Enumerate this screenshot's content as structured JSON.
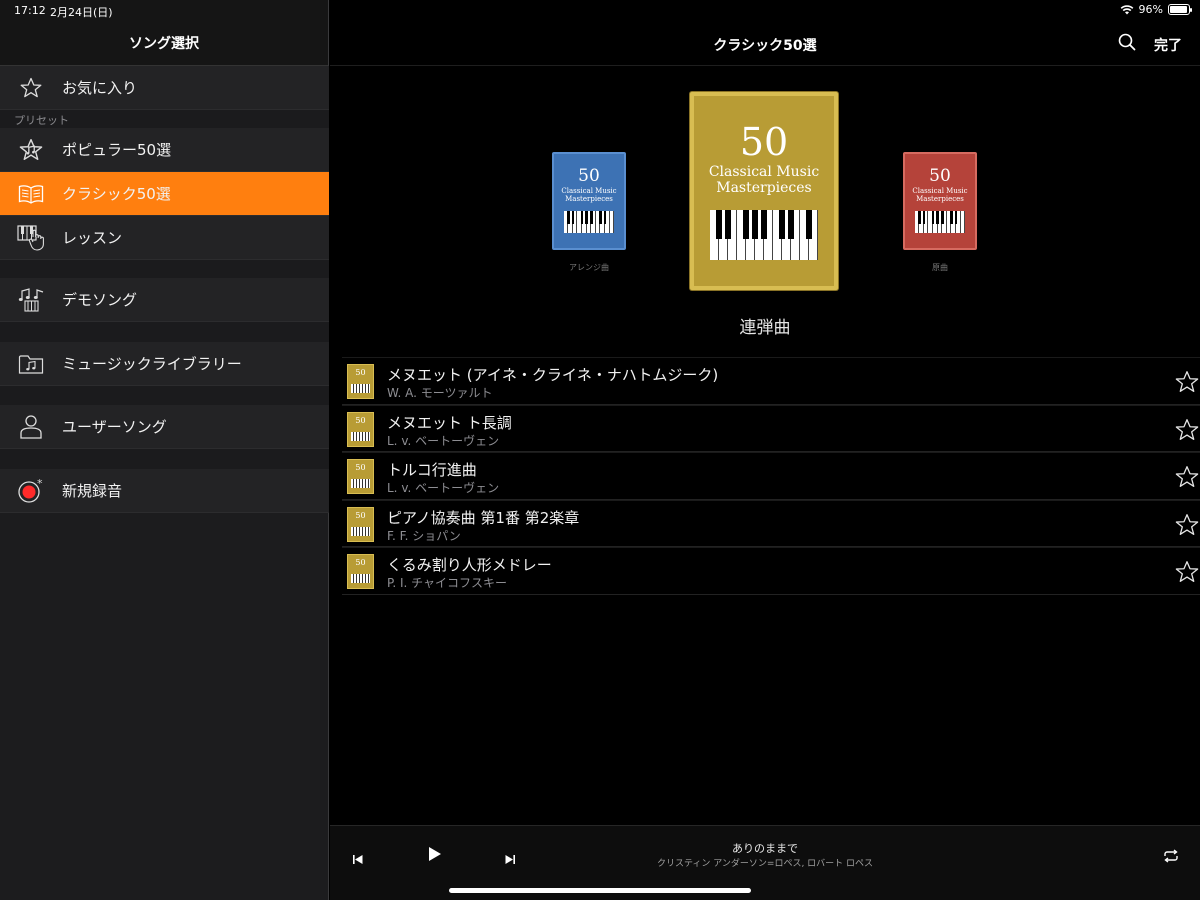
{
  "status": {
    "time": "17:12",
    "date": "2月24日(日)",
    "battery": "96%",
    "battery_level": 0.96
  },
  "sidebar": {
    "title": "ソング選択",
    "favorites": {
      "label": "お気に入り",
      "icon": "star-outline-icon"
    },
    "section_label": "プリセット",
    "presets": [
      {
        "label": "ポピュラー50選",
        "icon": "star-music-icon",
        "active": false
      },
      {
        "label": "クラシック50選",
        "icon": "open-book-icon",
        "active": true
      },
      {
        "label": "レッスン",
        "icon": "piano-hand-icon",
        "active": false
      }
    ],
    "demo": {
      "label": "デモソング",
      "icon": "music-notes-icon"
    },
    "library": {
      "label": "ミュージックライブラリー",
      "icon": "music-folder-icon"
    },
    "user": {
      "label": "ユーザーソング",
      "icon": "person-icon"
    },
    "record": {
      "label": "新規録音",
      "icon": "record-icon"
    }
  },
  "nav": {
    "title": "クラシック50選",
    "done": "完了"
  },
  "carousel": {
    "covers": [
      {
        "number": "50",
        "line1": "Classical Music",
        "line2": "Masterpieces",
        "label": "アレンジ曲",
        "color": "#3d72b4"
      },
      {
        "number": "50",
        "line1": "Classical Music",
        "line2": "Masterpieces",
        "label": "",
        "color": "#b89c35"
      },
      {
        "number": "50",
        "line1": "Classical Music",
        "line2": "Masterpieces",
        "label": "原曲",
        "color": "#b5433a"
      }
    ],
    "caption": "連弾曲"
  },
  "songs": [
    {
      "title": "メヌエット (アイネ・クライネ・ナハトムジーク)",
      "artist": "W. A. モーツァルト"
    },
    {
      "title": "メヌエット ト長調",
      "artist": "L. v. ベートーヴェン"
    },
    {
      "title": "トルコ行進曲",
      "artist": "L. v. ベートーヴェン"
    },
    {
      "title": "ピアノ協奏曲 第1番 第2楽章",
      "artist": "F. F. ショパン"
    },
    {
      "title": "くるみ割り人形メドレー",
      "artist": "P. I. チャイコフスキー"
    }
  ],
  "player": {
    "title": "ありのままで",
    "artist": "クリスティン アンダーソン=ロペス, ロバート ロペス"
  },
  "colors": {
    "accent": "#ff7f0f",
    "sidebar_bg": "#1c1c1e",
    "gold": "#b89c35"
  }
}
